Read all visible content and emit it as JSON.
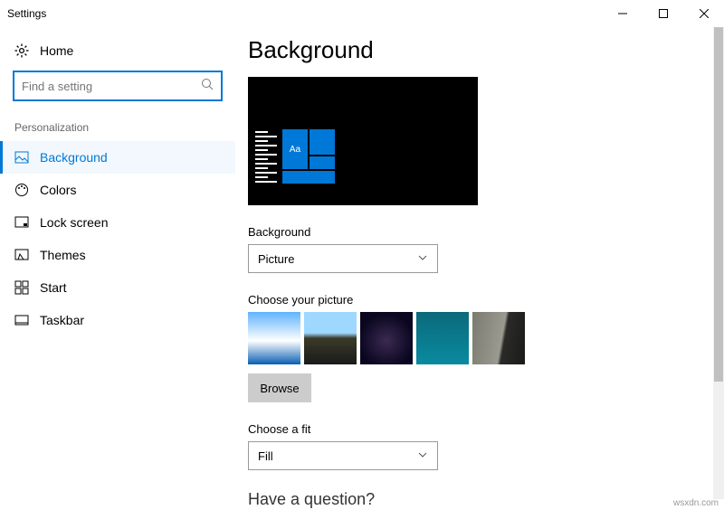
{
  "window": {
    "title": "Settings"
  },
  "sidebar": {
    "home": "Home",
    "search_placeholder": "Find a setting",
    "section": "Personalization",
    "items": [
      {
        "label": "Background"
      },
      {
        "label": "Colors"
      },
      {
        "label": "Lock screen"
      },
      {
        "label": "Themes"
      },
      {
        "label": "Start"
      },
      {
        "label": "Taskbar"
      }
    ]
  },
  "main": {
    "heading": "Background",
    "preview_tile_text": "Aa",
    "bg_label": "Background",
    "bg_value": "Picture",
    "choose_picture_label": "Choose your picture",
    "browse_label": "Browse",
    "fit_label": "Choose a fit",
    "fit_value": "Fill",
    "question_heading": "Have a question?"
  },
  "watermark": "wsxdn.com"
}
